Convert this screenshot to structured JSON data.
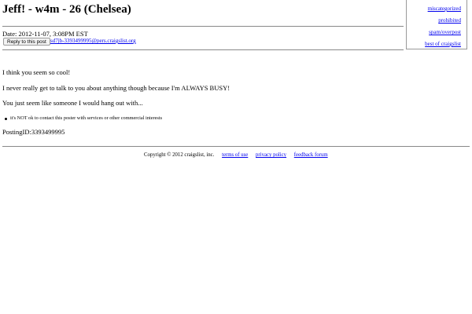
{
  "flag_box": {
    "items": [
      "miscategorized",
      "prohibited",
      "spam/overpost",
      "best of craigslist"
    ]
  },
  "post": {
    "title": "Jeff! - w4m - 26 (Chelsea)",
    "date_label": "Date: 2012-11-07, 3:08PM EST",
    "reply_button": "Reply to this post",
    "reply_email": "sd7jb-3393499995@pers.craigslist.org",
    "body_lines": [
      "I think you seem so cool!",
      "I never really get to talk to you about anything though because I'm ALWAYS BUSY!",
      "You just seem like someone I would hang out with..."
    ],
    "notice": "it's NOT ok to contact this poster with services or other commercial interests",
    "posting_id": "PostingID:3393499995"
  },
  "footer": {
    "copyright": "Copyright © 2012 craigslist, inc.",
    "links": [
      "terms of use",
      "privacy policy",
      "feedback forum"
    ]
  }
}
